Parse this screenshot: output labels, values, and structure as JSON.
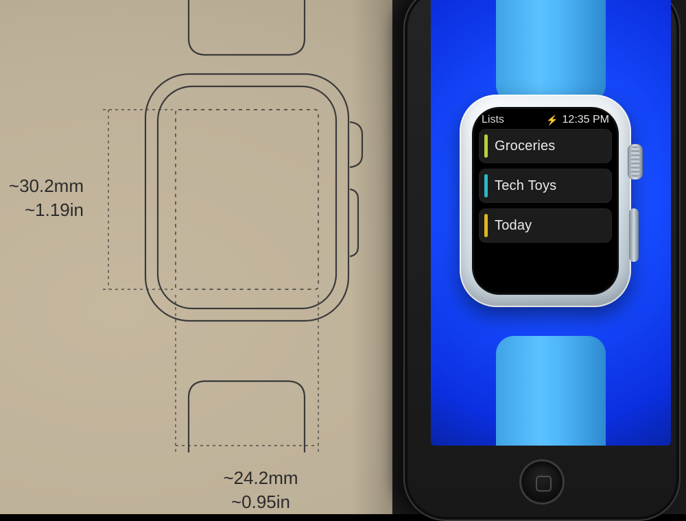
{
  "spec": {
    "height_mm": "~30.2mm",
    "height_in": "~1.19in",
    "width_mm": "~24.2mm",
    "width_in": "~0.95in"
  },
  "watch_ui": {
    "status": {
      "title": "Lists",
      "charging_icon": "bolt-icon",
      "time": "12:35 PM"
    },
    "rows": [
      {
        "label": "Groceries",
        "color": "#b7d23a"
      },
      {
        "label": "Tech Toys",
        "color": "#2fb8c6"
      },
      {
        "label": "Today",
        "color": "#e0b81e"
      }
    ]
  },
  "colors": {
    "band": "#4db6f8",
    "case": "#e4ecf2",
    "phone_screen_bg": "#1445ff"
  }
}
